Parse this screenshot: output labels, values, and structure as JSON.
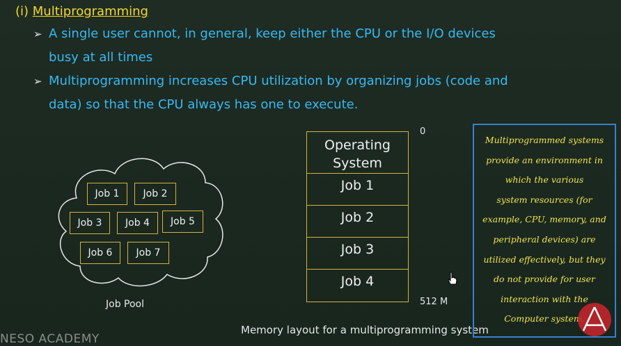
{
  "heading": {
    "prefix": "(i) ",
    "title": "Multiprogramming"
  },
  "bullets": [
    {
      "line1": "A single user cannot, in general, keep either the CPU or the I/O devices",
      "line2": "busy at all times"
    },
    {
      "line1": "Multiprogramming increases CPU utilization by organizing jobs (code and",
      "line2": "data) so that the CPU always has one to execute."
    }
  ],
  "job_pool": {
    "label": "Job Pool",
    "jobs": [
      "Job 1",
      "Job 2",
      "Job 3",
      "Job 4",
      "Job 5",
      "Job 6",
      "Job 7"
    ]
  },
  "memory": {
    "os_line1": "Operating",
    "os_line2": "System",
    "jobs": [
      "Job 1",
      "Job 2",
      "Job 3",
      "Job 4"
    ],
    "addr_top": "0",
    "addr_bottom": "512 M",
    "caption": "Memory layout for a multiprogramming system"
  },
  "note_lines": [
    "Multiprogrammed systems",
    "provide an environment in",
    "which the various",
    "system resources (for",
    "example, CPU, memory, and",
    "peripheral devices) are",
    "utilized effectively, but they",
    "do not provide for user",
    "interaction with the",
    "Computer system."
  ],
  "brand": "NESO ACADEMY",
  "colors": {
    "heading": "#f2d72e",
    "bullet": "#39b9f0",
    "box_border": "#d9b23a",
    "note_text": "#f3e34a",
    "note_border": "#3a7fd0",
    "logo": "#c1262b"
  },
  "icons": {
    "arrow": "arrow-bullet-icon",
    "cursor": "hand-cursor-icon",
    "logo": "neso-logo-icon"
  }
}
